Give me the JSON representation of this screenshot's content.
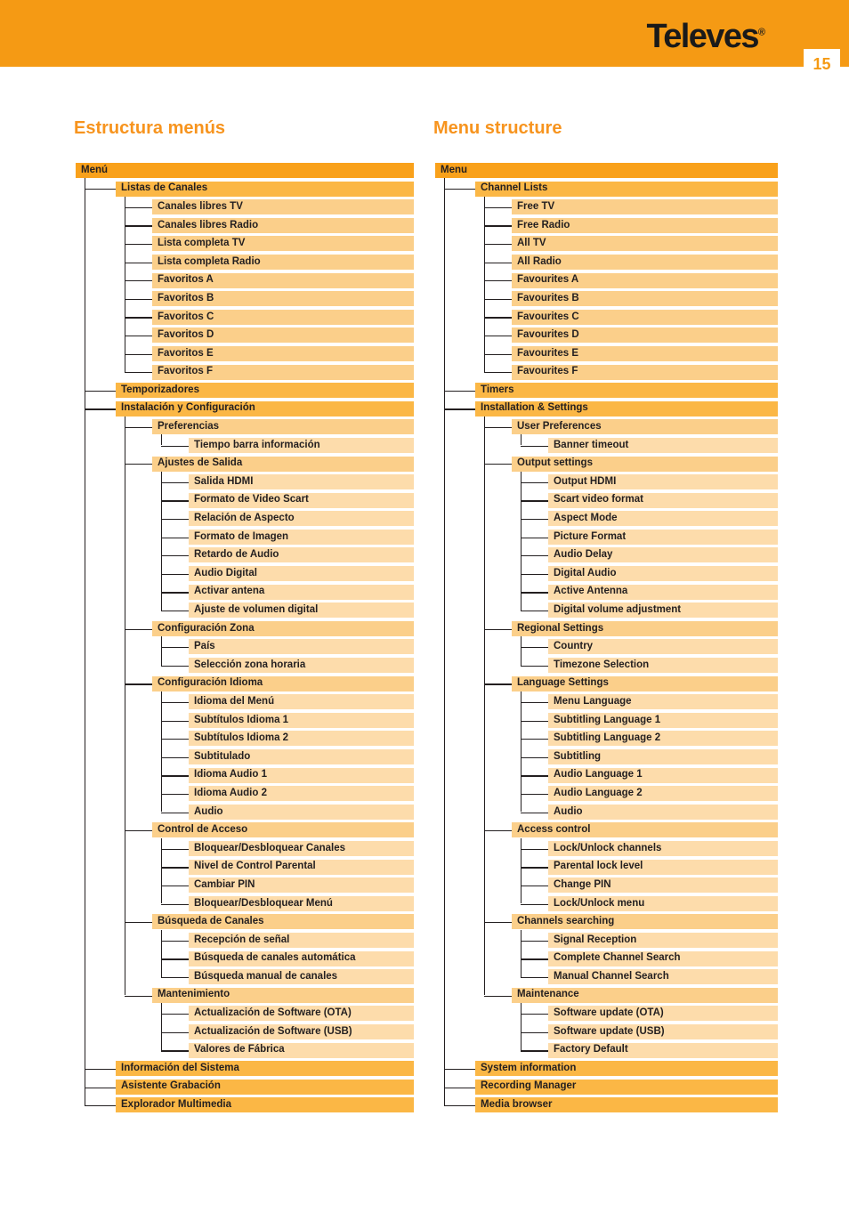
{
  "header": {
    "brand": "Televes",
    "brand_registered_mark": "®",
    "page_number": "15",
    "band_color": "#f59a14",
    "page_number_color": "#f59a14"
  },
  "colors": {
    "accent": "#f7941e",
    "level0_bar": "#f9a11b",
    "level1_bar": "#fbb745",
    "level2_bar": "#fbcf8a",
    "level3_bar": "#fddcab",
    "text": "#231f20"
  },
  "columns": [
    {
      "id": "es",
      "title": "Estructura menús",
      "language": "Spanish",
      "nodes": [
        {
          "depth": 0,
          "label": "Menú"
        },
        {
          "depth": 1,
          "label": "Listas de Canales"
        },
        {
          "depth": 2,
          "label": "Canales libres TV"
        },
        {
          "depth": 2,
          "label": "Canales libres Radio"
        },
        {
          "depth": 2,
          "label": "Lista completa TV"
        },
        {
          "depth": 2,
          "label": "Lista completa Radio"
        },
        {
          "depth": 2,
          "label": "Favoritos A"
        },
        {
          "depth": 2,
          "label": "Favoritos B"
        },
        {
          "depth": 2,
          "label": "Favoritos C"
        },
        {
          "depth": 2,
          "label": "Favoritos D"
        },
        {
          "depth": 2,
          "label": "Favoritos E"
        },
        {
          "depth": 2,
          "label": "Favoritos F"
        },
        {
          "depth": 1,
          "label": "Temporizadores"
        },
        {
          "depth": 1,
          "label": "Instalación y Configuración"
        },
        {
          "depth": 2,
          "label": "Preferencias"
        },
        {
          "depth": 3,
          "label": "Tiempo barra información"
        },
        {
          "depth": 2,
          "label": "Ajustes de Salida"
        },
        {
          "depth": 3,
          "label": "Salida HDMI"
        },
        {
          "depth": 3,
          "label": "Formato de Video Scart"
        },
        {
          "depth": 3,
          "label": "Relación de Aspecto"
        },
        {
          "depth": 3,
          "label": "Formato de Imagen"
        },
        {
          "depth": 3,
          "label": "Retardo de Audio"
        },
        {
          "depth": 3,
          "label": "Audio Digital"
        },
        {
          "depth": 3,
          "label": "Activar antena"
        },
        {
          "depth": 3,
          "label": "Ajuste de volumen digital"
        },
        {
          "depth": 2,
          "label": "Configuración Zona"
        },
        {
          "depth": 3,
          "label": "País"
        },
        {
          "depth": 3,
          "label": "Selección zona horaria"
        },
        {
          "depth": 2,
          "label": "Configuración Idioma"
        },
        {
          "depth": 3,
          "label": "Idioma del Menú"
        },
        {
          "depth": 3,
          "label": "Subtítulos Idioma 1"
        },
        {
          "depth": 3,
          "label": "Subtítulos Idioma 2"
        },
        {
          "depth": 3,
          "label": "Subtitulado"
        },
        {
          "depth": 3,
          "label": "Idioma Audio 1"
        },
        {
          "depth": 3,
          "label": "Idioma Audio 2"
        },
        {
          "depth": 3,
          "label": "Audio"
        },
        {
          "depth": 2,
          "label": "Control de Acceso"
        },
        {
          "depth": 3,
          "label": "Bloquear/Desbloquear Canales"
        },
        {
          "depth": 3,
          "label": "Nivel de Control Parental"
        },
        {
          "depth": 3,
          "label": "Cambiar PIN"
        },
        {
          "depth": 3,
          "label": "Bloquear/Desbloquear Menú"
        },
        {
          "depth": 2,
          "label": "Búsqueda de Canales"
        },
        {
          "depth": 3,
          "label": "Recepción de señal"
        },
        {
          "depth": 3,
          "label": "Búsqueda de canales automática"
        },
        {
          "depth": 3,
          "label": "Búsqueda manual de canales"
        },
        {
          "depth": 2,
          "label": "Mantenimiento"
        },
        {
          "depth": 3,
          "label": "Actualización de Software (OTA)"
        },
        {
          "depth": 3,
          "label": "Actualización de Software (USB)"
        },
        {
          "depth": 3,
          "label": "Valores de Fábrica"
        },
        {
          "depth": 1,
          "label": "Información del Sistema"
        },
        {
          "depth": 1,
          "label": "Asistente Grabación"
        },
        {
          "depth": 1,
          "label": "Explorador Multimedia"
        }
      ]
    },
    {
      "id": "en",
      "title": "Menu structure",
      "language": "English",
      "nodes": [
        {
          "depth": 0,
          "label": "Menu"
        },
        {
          "depth": 1,
          "label": "Channel Lists"
        },
        {
          "depth": 2,
          "label": "Free TV"
        },
        {
          "depth": 2,
          "label": "Free Radio"
        },
        {
          "depth": 2,
          "label": "All TV"
        },
        {
          "depth": 2,
          "label": "All Radio"
        },
        {
          "depth": 2,
          "label": "Favourites A"
        },
        {
          "depth": 2,
          "label": "Favourites B"
        },
        {
          "depth": 2,
          "label": "Favourites C"
        },
        {
          "depth": 2,
          "label": "Favourites D"
        },
        {
          "depth": 2,
          "label": "Favourites E"
        },
        {
          "depth": 2,
          "label": "Favourites F"
        },
        {
          "depth": 1,
          "label": "Timers"
        },
        {
          "depth": 1,
          "label": "Installation & Settings"
        },
        {
          "depth": 2,
          "label": "User Preferences"
        },
        {
          "depth": 3,
          "label": "Banner timeout"
        },
        {
          "depth": 2,
          "label": "Output settings"
        },
        {
          "depth": 3,
          "label": "Output HDMI"
        },
        {
          "depth": 3,
          "label": "Scart video format"
        },
        {
          "depth": 3,
          "label": "Aspect Mode"
        },
        {
          "depth": 3,
          "label": "Picture Format"
        },
        {
          "depth": 3,
          "label": "Audio Delay"
        },
        {
          "depth": 3,
          "label": "Digital Audio"
        },
        {
          "depth": 3,
          "label": "Active Antenna"
        },
        {
          "depth": 3,
          "label": "Digital volume adjustment"
        },
        {
          "depth": 2,
          "label": "Regional Settings"
        },
        {
          "depth": 3,
          "label": "Country"
        },
        {
          "depth": 3,
          "label": "Timezone Selection"
        },
        {
          "depth": 2,
          "label": "Language Settings"
        },
        {
          "depth": 3,
          "label": "Menu Language"
        },
        {
          "depth": 3,
          "label": "Subtitling Language 1"
        },
        {
          "depth": 3,
          "label": "Subtitling Language 2"
        },
        {
          "depth": 3,
          "label": "Subtitling"
        },
        {
          "depth": 3,
          "label": "Audio Language 1"
        },
        {
          "depth": 3,
          "label": "Audio Language 2"
        },
        {
          "depth": 3,
          "label": "Audio"
        },
        {
          "depth": 2,
          "label": "Access control"
        },
        {
          "depth": 3,
          "label": "Lock/Unlock channels"
        },
        {
          "depth": 3,
          "label": "Parental lock level"
        },
        {
          "depth": 3,
          "label": "Change PIN"
        },
        {
          "depth": 3,
          "label": "Lock/Unlock menu"
        },
        {
          "depth": 2,
          "label": "Channels searching"
        },
        {
          "depth": 3,
          "label": "Signal Reception"
        },
        {
          "depth": 3,
          "label": "Complete Channel Search"
        },
        {
          "depth": 3,
          "label": "Manual Channel Search"
        },
        {
          "depth": 2,
          "label": "Maintenance"
        },
        {
          "depth": 3,
          "label": "Software update (OTA)"
        },
        {
          "depth": 3,
          "label": "Software update (USB)"
        },
        {
          "depth": 3,
          "label": "Factory Default"
        },
        {
          "depth": 1,
          "label": "System information"
        },
        {
          "depth": 1,
          "label": "Recording Manager"
        },
        {
          "depth": 1,
          "label": "Media browser"
        }
      ]
    }
  ]
}
